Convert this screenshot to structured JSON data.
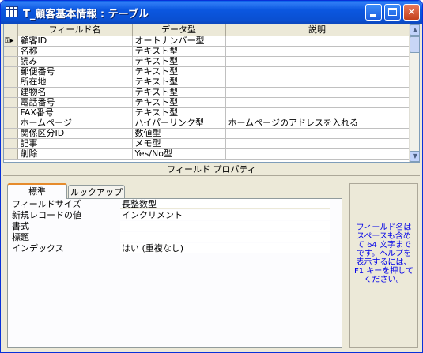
{
  "window": {
    "title": "T_顧客基本情報 : テーブル",
    "min_glyph": "_",
    "max_glyph": "□",
    "close_glyph": "✕"
  },
  "grid": {
    "columns": [
      "フィールド名",
      "データ型",
      "説明"
    ],
    "primary_key_marker": "⚿▸",
    "rows": [
      {
        "name": "顧客ID",
        "type": "オートナンバー型",
        "desc": ""
      },
      {
        "name": "名称",
        "type": "テキスト型",
        "desc": ""
      },
      {
        "name": "読み",
        "type": "テキスト型",
        "desc": ""
      },
      {
        "name": "郵便番号",
        "type": "テキスト型",
        "desc": ""
      },
      {
        "name": "所在地",
        "type": "テキスト型",
        "desc": ""
      },
      {
        "name": "建物名",
        "type": "テキスト型",
        "desc": ""
      },
      {
        "name": "電話番号",
        "type": "テキスト型",
        "desc": ""
      },
      {
        "name": "FAX番号",
        "type": "テキスト型",
        "desc": ""
      },
      {
        "name": "ホームページ",
        "type": "ハイパーリンク型",
        "desc": "ホームページのアドレスを入れる"
      },
      {
        "name": "関係区分ID",
        "type": "数値型",
        "desc": ""
      },
      {
        "name": "記事",
        "type": "メモ型",
        "desc": ""
      },
      {
        "name": "削除",
        "type": "Yes/No型",
        "desc": ""
      }
    ],
    "scroll_up": "▲",
    "scroll_down": "▼"
  },
  "properties": {
    "header": "フィールド プロパティ",
    "tabs": [
      "標準",
      "ルックアップ"
    ],
    "items": [
      {
        "label": "フィールドサイズ",
        "value": "長整数型"
      },
      {
        "label": "新規レコードの値",
        "value": "インクリメント"
      },
      {
        "label": "書式",
        "value": ""
      },
      {
        "label": "標題",
        "value": ""
      },
      {
        "label": "インデックス",
        "value": "はい (重複なし)"
      }
    ],
    "help_text": "フィールド名はスペースも含めて 64 文字までです。ヘルプを表示するには、F1 キーを押してください。"
  }
}
